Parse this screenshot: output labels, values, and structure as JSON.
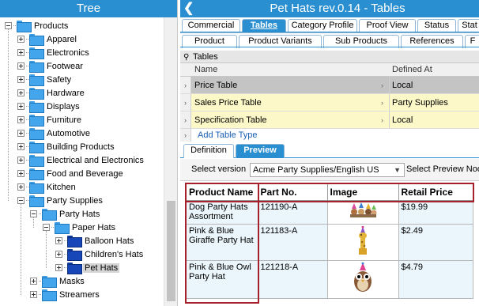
{
  "tree": {
    "title": "Tree",
    "nodes": [
      {
        "label": "Products",
        "depth": 0,
        "toggle": "minus",
        "dark": false
      },
      {
        "label": "Apparel",
        "depth": 1,
        "toggle": "plus",
        "dark": false
      },
      {
        "label": "Electronics",
        "depth": 1,
        "toggle": "plus",
        "dark": false
      },
      {
        "label": "Footwear",
        "depth": 1,
        "toggle": "plus",
        "dark": false
      },
      {
        "label": "Safety",
        "depth": 1,
        "toggle": "plus",
        "dark": false
      },
      {
        "label": "Hardware",
        "depth": 1,
        "toggle": "plus",
        "dark": false
      },
      {
        "label": "Displays",
        "depth": 1,
        "toggle": "plus",
        "dark": false
      },
      {
        "label": "Furniture",
        "depth": 1,
        "toggle": "plus",
        "dark": false
      },
      {
        "label": "Automotive",
        "depth": 1,
        "toggle": "plus",
        "dark": false
      },
      {
        "label": "Building Products",
        "depth": 1,
        "toggle": "plus",
        "dark": false
      },
      {
        "label": "Electrical and Electronics",
        "depth": 1,
        "toggle": "plus",
        "dark": false
      },
      {
        "label": "Food and Beverage",
        "depth": 1,
        "toggle": "plus",
        "dark": false
      },
      {
        "label": "Kitchen",
        "depth": 1,
        "toggle": "plus",
        "dark": false
      },
      {
        "label": "Party Supplies",
        "depth": 1,
        "toggle": "minus",
        "dark": false
      },
      {
        "label": "Party Hats",
        "depth": 2,
        "toggle": "minus",
        "dark": false
      },
      {
        "label": "Paper Hats",
        "depth": 3,
        "toggle": "minus",
        "dark": false
      },
      {
        "label": "Balloon Hats",
        "depth": 4,
        "toggle": "plus",
        "dark": true
      },
      {
        "label": "Children's Hats",
        "depth": 4,
        "toggle": "plus",
        "dark": true
      },
      {
        "label": "Pet Hats",
        "depth": 4,
        "toggle": "plus",
        "dark": true,
        "selected": true
      },
      {
        "label": "Masks",
        "depth": 2,
        "toggle": "plus",
        "dark": false
      },
      {
        "label": "Streamers",
        "depth": 2,
        "toggle": "plus",
        "dark": false
      }
    ]
  },
  "detail": {
    "title": "Pet Hats rev.0.14 - Tables",
    "tabs_row1": [
      {
        "label": "Commercial",
        "active": false
      },
      {
        "label": "Tables",
        "active": true
      },
      {
        "label": "Category Profile",
        "active": false
      },
      {
        "label": "Proof View",
        "active": false
      },
      {
        "label": "Status",
        "active": false
      },
      {
        "label": "Stat",
        "active": false
      }
    ],
    "tabs_row2": [
      {
        "label": "Product"
      },
      {
        "label": "Product Variants"
      },
      {
        "label": "Sub Products"
      },
      {
        "label": "References"
      },
      {
        "label": "F"
      }
    ],
    "tables_section": {
      "title": "Tables",
      "col_name": "Name",
      "col_defined": "Defined At",
      "rows": [
        {
          "name": "Price Table",
          "defined_at": "Local",
          "style": "sel"
        },
        {
          "name": "Sales Price Table",
          "defined_at": "Party Supplies",
          "style": "yel"
        },
        {
          "name": "Specification Table",
          "defined_at": "Local",
          "style": "yel"
        }
      ],
      "add_label": "Add Table Type"
    },
    "subtabs": [
      {
        "label": "Definition",
        "active": false
      },
      {
        "label": "Preview",
        "active": true
      }
    ],
    "version": {
      "label": "Select version",
      "value": "Acme Party Supplies/English US",
      "preview_node_label": "Select Preview Nod"
    },
    "preview_table": {
      "headers": [
        "Product Name",
        "Part No.",
        "Image",
        "Retail Price"
      ],
      "rows": [
        {
          "name": "Dog Party Hats Assortment",
          "part": "121190-A",
          "image": "dogs-with-hats-image",
          "price": "$19.99"
        },
        {
          "name": "Pink & Blue Giraffe Party Hat",
          "part": "121183-A",
          "image": "giraffe-with-hat-image",
          "price": "$2.49"
        },
        {
          "name": "Pink & Blue Owl Party Hat",
          "part": "121218-A",
          "image": "owl-with-hat-image",
          "price": "$4.79"
        }
      ]
    }
  }
}
